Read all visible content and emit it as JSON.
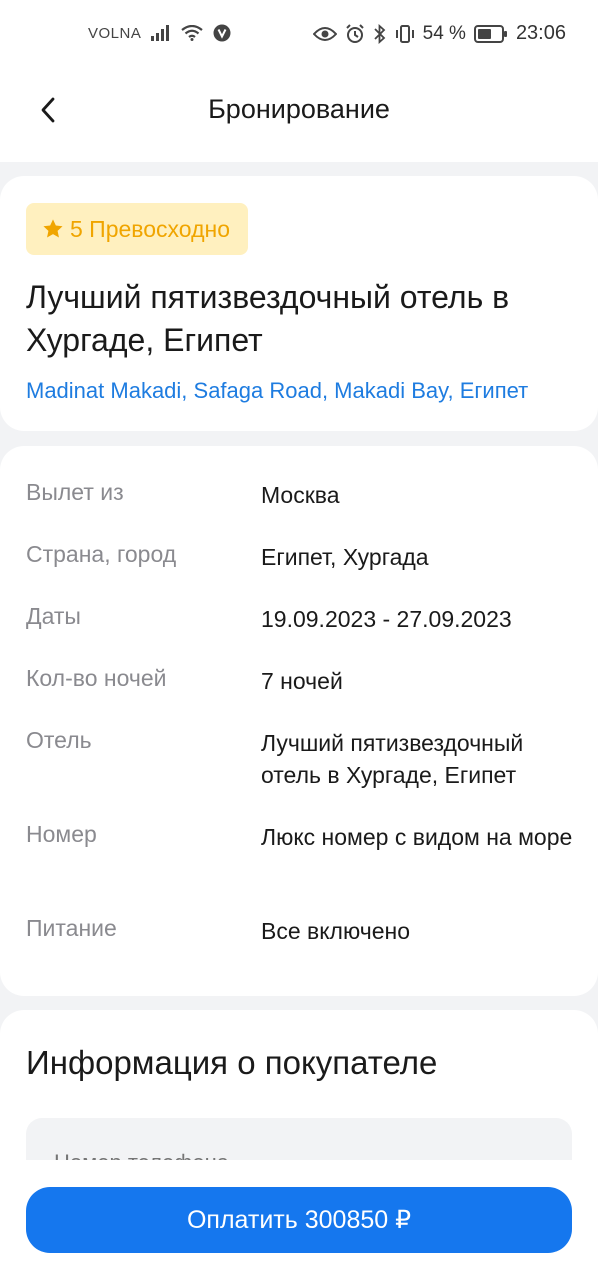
{
  "status_bar": {
    "carrier": "VOLNA",
    "battery_percent": "54 %",
    "time": "23:06"
  },
  "header": {
    "title": "Бронирование"
  },
  "hotel": {
    "rating_label": "5 Превосходно",
    "name": "Лучший пятизвездочный отель в Хургаде, Египет",
    "address": "Madinat Makadi, Safaga Road, Makadi Bay, Египет"
  },
  "details": [
    {
      "label": "Вылет из",
      "value": "Москва"
    },
    {
      "label": "Страна, город",
      "value": "Египет, Хургада"
    },
    {
      "label": "Даты",
      "value": "19.09.2023 - 27.09.2023"
    },
    {
      "label": "Кол-во ночей",
      "value": "7 ночей"
    },
    {
      "label": "Отель",
      "value": "Лучший пятизвездочный отель в Хургаде, Египет"
    },
    {
      "label": "Номер",
      "value": "Люкс номер с видом на море"
    },
    {
      "label": "Питание",
      "value": "Все включено"
    }
  ],
  "buyer": {
    "title": "Информация о покупателе",
    "phone_placeholder": "Номер телефона"
  },
  "pay_button_label": "Оплатить 300850 ₽",
  "colors": {
    "accent": "#1577EE",
    "link": "#1E7CE0",
    "rating_text": "#F0A500",
    "rating_bg": "#FFF0BF"
  }
}
